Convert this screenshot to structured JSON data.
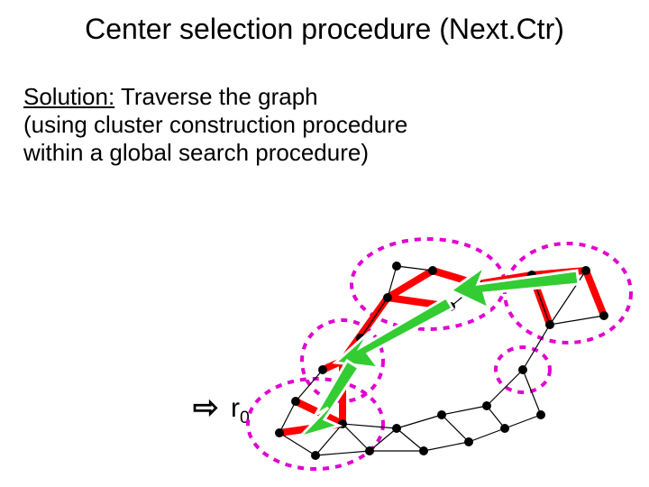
{
  "title": "Center selection procedure (Next.Ctr)",
  "solution_label": "Solution:",
  "solution_rest": " Traverse the graph",
  "line2": "(using cluster construction procedure",
  "line3": " within a global search procedure)",
  "arrow_glyph": "⇨",
  "r0_label": "r",
  "r0_sub": "0"
}
